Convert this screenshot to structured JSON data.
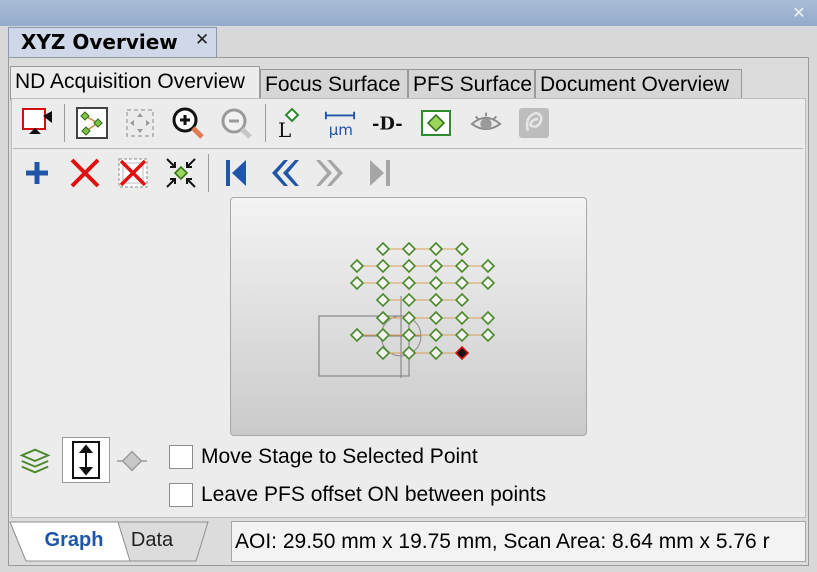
{
  "window": {
    "close_icon": "close-icon"
  },
  "panel": {
    "title": "XYZ Overview",
    "close_glyph": "✕"
  },
  "tabs": [
    {
      "label": "ND Acquisition Overview",
      "active": true
    },
    {
      "label": "Focus Surface",
      "active": false
    },
    {
      "label": "PFS Surface",
      "active": false
    },
    {
      "label": "Document Overview",
      "active": false
    }
  ],
  "toolbar1": {
    "icons": [
      "snapshot-icon",
      "select-points-icon",
      "fit-view-icon",
      "zoom-in-icon",
      "zoom-out-icon",
      "l-marker-icon",
      "scale-um-icon",
      "d-marker-icon",
      "diamond-point-icon",
      "eye-icon",
      "disabled-overlay-icon"
    ],
    "um_label": "μm",
    "l_label": "L",
    "d_label": "-D-"
  },
  "toolbar2": {
    "icons": [
      "add-icon",
      "delete-icon",
      "delete-all-icon",
      "collapse-icon",
      "first-icon",
      "previous-icon",
      "next-icon",
      "last-icon"
    ]
  },
  "options": {
    "move_stage_label": "Move Stage to Selected Point",
    "move_stage_checked": false,
    "leave_pfs_label": "Leave PFS offset ON between points",
    "leave_pfs_checked": false
  },
  "bottom_tabs": [
    {
      "label": "Graph",
      "active": true
    },
    {
      "label": "Data",
      "active": false
    }
  ],
  "status": {
    "text": "AOI: 29.50 mm x 19.75 mm, Scan Area: 8.64 mm x 5.76 r"
  },
  "colors": {
    "accent": "#1f56a8",
    "point": "#4a8a2a",
    "selected_point": "#d01010",
    "delete": "#e01010"
  }
}
